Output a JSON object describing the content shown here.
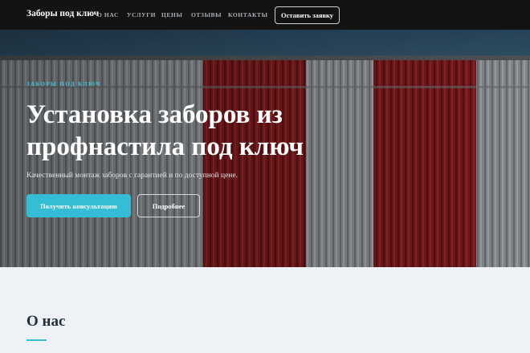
{
  "header": {
    "logo": "Заборы под ключ",
    "nav": [
      {
        "label": "О НАС"
      },
      {
        "label": "УСЛУГИ"
      },
      {
        "label": "ЦЕНЫ"
      },
      {
        "label": "ОТЗЫВЫ"
      },
      {
        "label": "КОНТАКТЫ"
      }
    ],
    "cta_label": "Оставить заявку"
  },
  "hero": {
    "eyebrow": "ЗАБОРЫ ПОД КЛЮЧ",
    "title": "Установка заборов из профнастила под ключ",
    "subtitle": "Качественный монтаж заборов с гарантией и по доступной цене.",
    "primary_button": "Получить консультацию",
    "secondary_button": "Подробнее"
  },
  "about": {
    "title": "О нас"
  },
  "colors": {
    "accent": "#36bdd6",
    "header_bg": "#131313",
    "section_bg": "#eef2f6",
    "fence_red": "#7d1c1f",
    "fence_grey": "#8a8f93"
  }
}
